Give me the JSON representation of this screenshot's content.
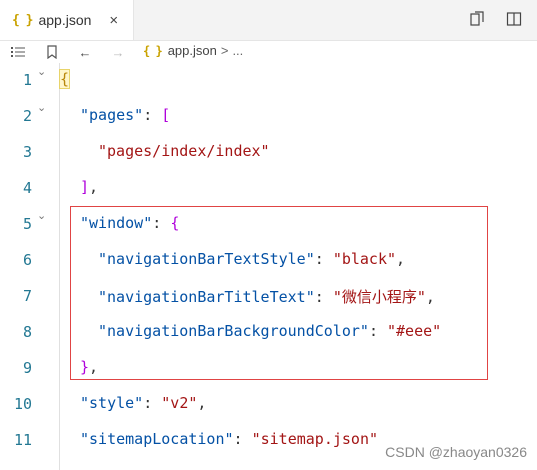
{
  "tab": {
    "icon": "{ }",
    "label": "app.json",
    "close": "×"
  },
  "toolbar": {
    "open_changes": "open-changes-icon",
    "split": "split-editor-icon"
  },
  "breadcrumb": {
    "list_icon": "≡",
    "bookmark_icon": "bookmark-icon",
    "back": "←",
    "forward": "→",
    "file_icon": "{ }",
    "file": "app.json",
    "separator": ">",
    "more": "..."
  },
  "lines": [
    {
      "n": "1"
    },
    {
      "n": "2",
      "key": "\"pages\"",
      "colon": ": ",
      "open": "["
    },
    {
      "n": "3",
      "val": "\"pages/index/index\""
    },
    {
      "n": "4",
      "close": "]",
      "comma": ","
    },
    {
      "n": "5",
      "key": "\"window\"",
      "colon": ": ",
      "open": "{"
    },
    {
      "n": "6",
      "key": "\"navigationBarTextStyle\"",
      "colon": ": ",
      "val": "\"black\"",
      "comma": ","
    },
    {
      "n": "7",
      "key": "\"navigationBarTitleText\"",
      "colon": ": ",
      "val": "\"微信小程序\"",
      "comma": ","
    },
    {
      "n": "8",
      "key": "\"navigationBarBackgroundColor\"",
      "colon": ": ",
      "val": "\"#eee\""
    },
    {
      "n": "9",
      "close": "}",
      "comma": ","
    },
    {
      "n": "10",
      "key": "\"style\"",
      "colon": ": ",
      "val": "\"v2\"",
      "comma": ","
    },
    {
      "n": "11",
      "key": "\"sitemapLocation\"",
      "colon": ": ",
      "val": "\"sitemap.json\""
    }
  ],
  "line1": {
    "brace": "{"
  },
  "watermark": "CSDN @zhaoyan0326",
  "colors": {
    "key": "#0451a5",
    "string": "#a31515",
    "line_number": "#237893",
    "highlight_box": "#e04444"
  }
}
